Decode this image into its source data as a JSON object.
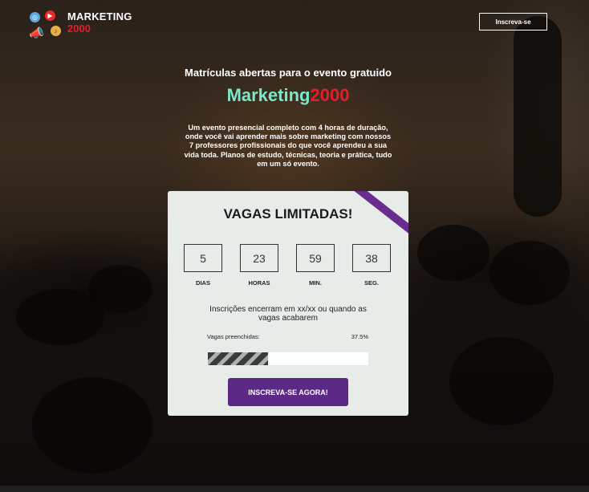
{
  "header": {
    "logo_title": "MARKETING",
    "logo_subtitle": "2000",
    "cta_label": "Inscreva-se",
    "icons": [
      "globe-icon",
      "play-icon",
      "megaphone-icon",
      "music-icon"
    ]
  },
  "hero": {
    "kicker": "Matrículas abertas para o evento gratuido",
    "title_part1": "Marketing",
    "title_part2": "2000",
    "description": "Um evento presencial completo com 4 horas de duração, onde você vai aprender mais sobre marketing com nossos 7 professores profissionais do que você aprendeu a sua vida toda. Planos de estudo, técnicas, teoria e prática, tudo em um só evento."
  },
  "card": {
    "title": "VAGAS LIMITADAS!",
    "countdown": [
      {
        "value": "5",
        "label": "DIAS"
      },
      {
        "value": "23",
        "label": "HORAS"
      },
      {
        "value": "59",
        "label": "MIN."
      },
      {
        "value": "38",
        "label": "SEG."
      }
    ],
    "closing_text": "Inscrições encerram em xx/xx ou quando as vagas acabarem",
    "fill_label": "Vagas preenchidas:",
    "fill_percent_text": "37.5%",
    "fill_fraction": 0.375,
    "cta_label": "INSCREVA-SE AGORA!"
  },
  "colors": {
    "accent_purple": "#5c2a86",
    "brand_red": "#e21f2b",
    "brand_mint": "#7be8c7"
  }
}
